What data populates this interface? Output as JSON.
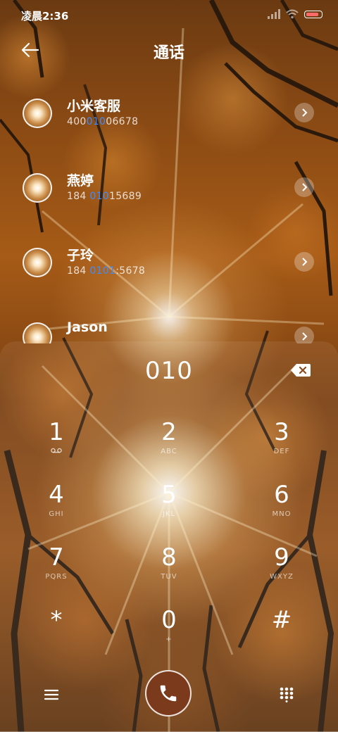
{
  "status_bar": {
    "time": "凌晨2:36"
  },
  "header": {
    "title": "通话"
  },
  "contacts": [
    {
      "name": "小米客服",
      "number_parts": [
        "400",
        "010",
        "06678"
      ]
    },
    {
      "name": "燕婷",
      "number_parts": [
        "184 ",
        "010",
        "15689"
      ]
    },
    {
      "name": "子玲",
      "number_parts": [
        "184 ",
        "0101",
        ":5678"
      ]
    },
    {
      "name": "Jason",
      "number_parts": [
        "",
        "",
        ""
      ]
    }
  ],
  "dialpad": {
    "input": "010",
    "keys": [
      {
        "digit": "1",
        "letters": ""
      },
      {
        "digit": "2",
        "letters": "ABC"
      },
      {
        "digit": "3",
        "letters": "DEF"
      },
      {
        "digit": "4",
        "letters": "GHI"
      },
      {
        "digit": "5",
        "letters": "JKL"
      },
      {
        "digit": "6",
        "letters": "MNO"
      },
      {
        "digit": "7",
        "letters": "PQRS"
      },
      {
        "digit": "8",
        "letters": "TUV"
      },
      {
        "digit": "9",
        "letters": "WXYZ"
      },
      {
        "digit": "*",
        "letters": ""
      },
      {
        "digit": "0",
        "letters": "+"
      },
      {
        "digit": "#",
        "letters": ""
      }
    ]
  },
  "colors": {
    "highlight": "#3d8dff",
    "call_button": "#7b3a1b",
    "battery": "#ff6b6b"
  },
  "icons": {
    "back": "arrow-left-icon",
    "detail": "chevron-right-icon",
    "backspace": "backspace-icon",
    "voicemail": "voicemail-icon",
    "menu": "menu-icon",
    "call": "phone-icon",
    "keypad": "dialpad-icon"
  }
}
